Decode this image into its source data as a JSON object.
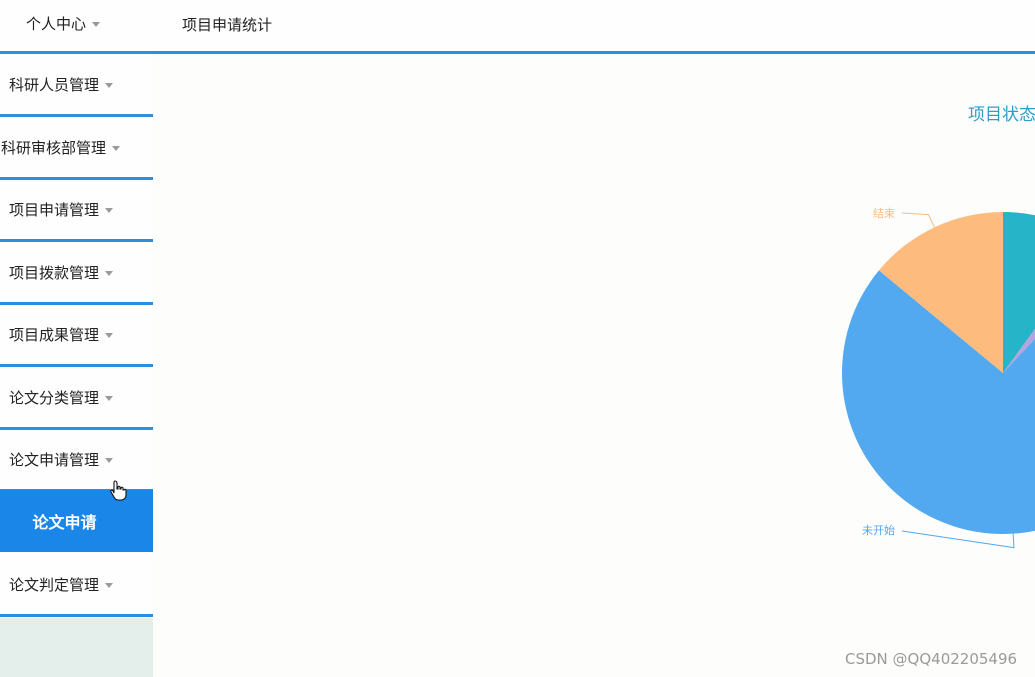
{
  "header": {
    "personal_center": "个人中心",
    "page_title": "项目申请统计"
  },
  "sidebar": {
    "items": [
      {
        "label": "科研人员管理"
      },
      {
        "label": "科研审核部管理"
      },
      {
        "label": "项目申请管理"
      },
      {
        "label": "项目拨款管理"
      },
      {
        "label": "项目成果管理"
      },
      {
        "label": "论文分类管理"
      },
      {
        "label": "论文申请管理"
      },
      {
        "label": "论文判定管理"
      }
    ],
    "active_sub": "论文申请"
  },
  "chart_data": {
    "type": "pie",
    "title": "项目状态",
    "slices": [
      {
        "name": "",
        "value": 10,
        "color": "#26b5c8"
      },
      {
        "name": "",
        "value": 2,
        "color": "#b5a3dc"
      },
      {
        "name": "未开始",
        "value": 74,
        "color": "#52a9f0"
      },
      {
        "name": "结束",
        "value": 14,
        "color": "#fdbc7e"
      }
    ]
  },
  "watermark": "CSDN @QQ402205496",
  "colors": {
    "accent": "#2b8fe0",
    "active_bg": "#1a86e8",
    "chart_title": "#2aa0c7"
  }
}
